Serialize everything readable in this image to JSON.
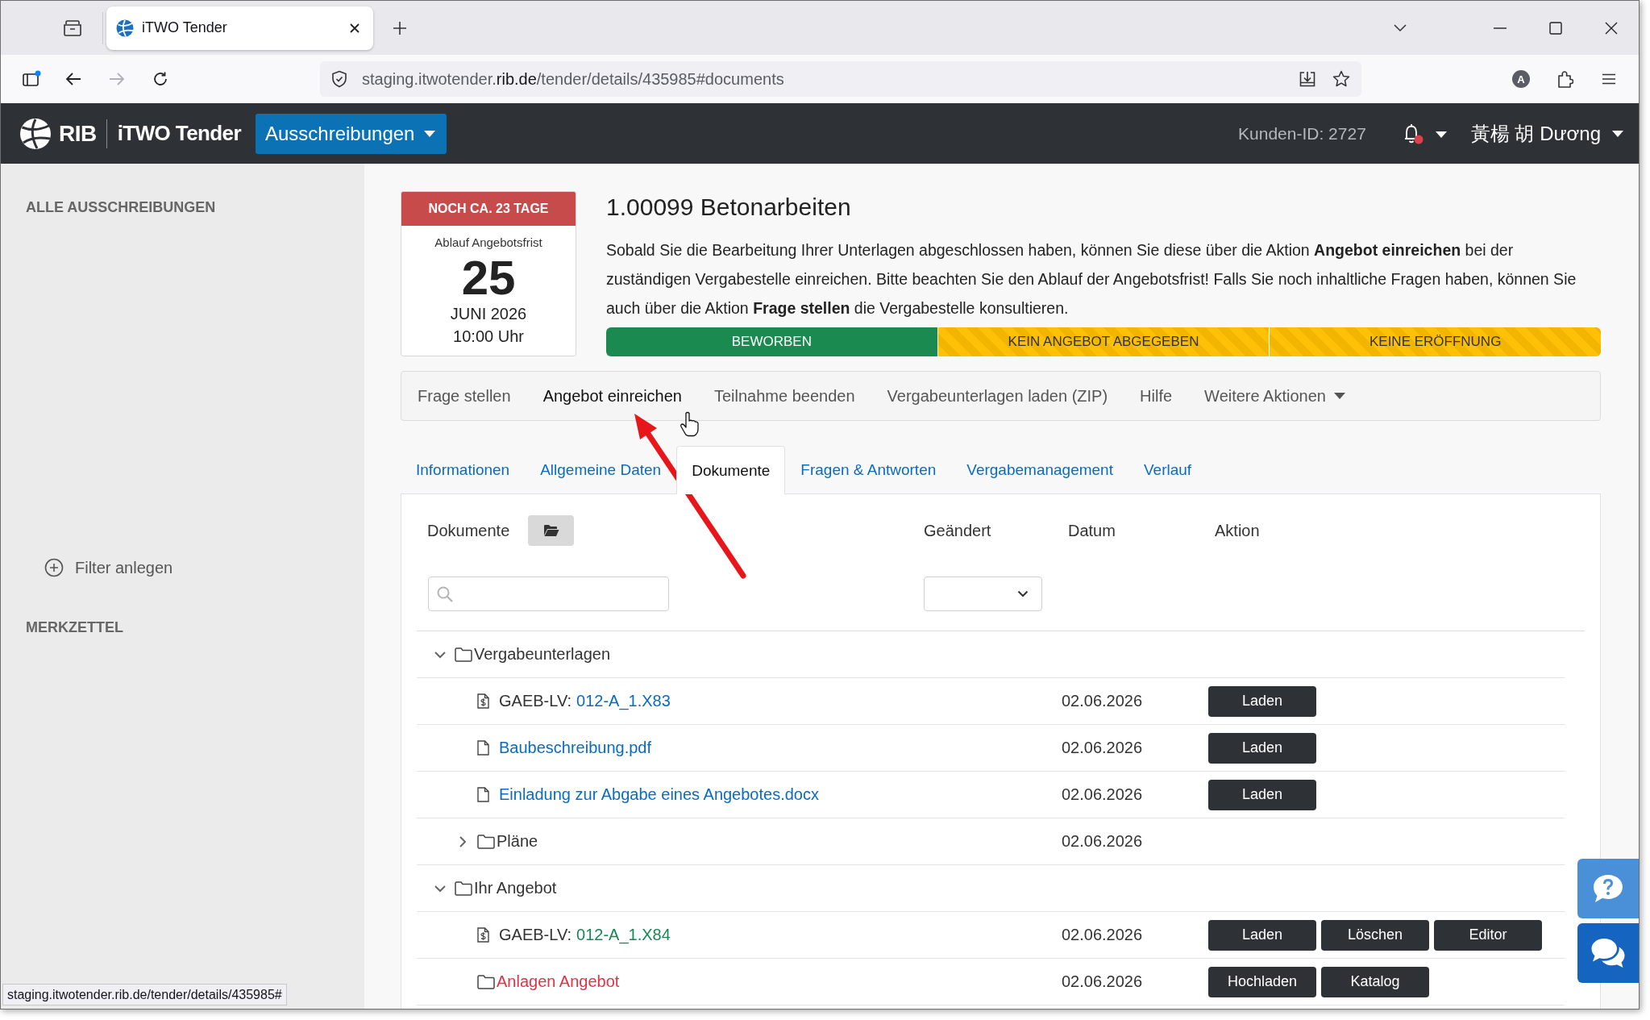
{
  "browser": {
    "tab_title": "iTWO Tender",
    "url": {
      "host": "staging.itwotender.",
      "domain": "rib.de",
      "path": "/tender/details/435985#documents"
    },
    "forward_disabled": true,
    "profile_initial": "A",
    "hover_url": "staging.itwotender.rib.de/tender/details/435985#"
  },
  "header": {
    "brand": "RIB",
    "product": "iTWO Tender",
    "menu": "Ausschreibungen",
    "customer_id": "Kunden-ID: 2727",
    "unread_notifications": true,
    "user": "黃楊 胡 Dương"
  },
  "sidebar": {
    "sections": [
      {
        "title": "ALLE AUSSCHREIBUNGEN",
        "action": "Filter anlegen"
      },
      {
        "title": "MERKZETTEL"
      }
    ]
  },
  "deadline": {
    "badge": "NOCH CA. 23 TAGE",
    "label": "Ablauf Angebotsfrist",
    "day": "25",
    "month": "JUNI 2026",
    "time": "10:00 Uhr"
  },
  "tender": {
    "title": "1.00099 Betonarbeiten",
    "description": "Sobald Sie die Bearbeitung Ihrer Unterlagen abgeschlossen haben, können Sie diese über die Aktion **Angebot einreichen** bei der zuständigen Vergabestelle einreichen. Bitte beachten Sie den Ablauf der Angebotsfrist! Falls Sie noch inhaltliche Fragen haben, können Sie auch über die Aktion **Frage stellen** die Vergabestelle konsultieren."
  },
  "status_steps": [
    {
      "label": "BEWORBEN",
      "done": true
    },
    {
      "label": "KEIN ANGEBOT ABGEGEBEN",
      "done": false
    },
    {
      "label": "KEINE ERÖFFNUNG",
      "done": false
    }
  ],
  "actions": [
    {
      "label": "Frage stellen",
      "kind": "link",
      "highlighted": false
    },
    {
      "label": "Angebot einreichen",
      "kind": "link",
      "highlighted": true
    },
    {
      "label": "Teilnahme beenden",
      "kind": "link",
      "highlighted": false
    },
    {
      "label": "Vergabeunterlagen laden (ZIP)",
      "kind": "link",
      "highlighted": false
    },
    {
      "label": "Hilfe",
      "kind": "link",
      "highlighted": false
    },
    {
      "label": "Weitere Aktionen",
      "kind": "dropdown",
      "highlighted": false
    }
  ],
  "tabs": [
    {
      "label": "Informationen",
      "selected": false
    },
    {
      "label": "Allgemeine Daten",
      "selected": false
    },
    {
      "label": "Dokumente",
      "selected": true
    },
    {
      "label": "Fragen & Antworten",
      "selected": false
    },
    {
      "label": "Vergabemanagement",
      "selected": false
    },
    {
      "label": "Verlauf",
      "selected": false
    }
  ],
  "documents": {
    "title": "Dokumente",
    "columns": [
      "Geändert",
      "Datum",
      "Aktion"
    ],
    "tree": [
      {
        "kind": "folder",
        "name": "Vergabeunterlagen",
        "expanded": true,
        "children": [
          {
            "kind": "spec",
            "prefix": "GAEB-LV:",
            "name": "012-A_1.X83",
            "color": "#0b6bbf",
            "date": "02.06.2026",
            "buttons": [
              "Laden"
            ]
          },
          {
            "kind": "file",
            "name": "Baubeschreibung.pdf",
            "color": "#0b6bbf",
            "date": "02.06.2026",
            "buttons": [
              "Laden"
            ]
          },
          {
            "kind": "file",
            "name": "Einladung zur Abgabe eines Angebotes.docx",
            "color": "#0b6bbf",
            "date": "02.06.2026",
            "buttons": [
              "Laden"
            ]
          },
          {
            "kind": "folder",
            "name": "Pläne",
            "expanded": false,
            "date": "02.06.2026"
          }
        ]
      },
      {
        "kind": "folder",
        "name": "Ihr Angebot",
        "expanded": true,
        "children": [
          {
            "kind": "spec",
            "prefix": "GAEB-LV:",
            "name": "012-A_1.X84",
            "color": "#198754",
            "date": "02.06.2026",
            "buttons": [
              "Laden",
              "Löschen",
              "Editor"
            ]
          },
          {
            "kind": "folder",
            "name": "Anlagen Angebot",
            "color": "#dc3545",
            "date": "02.06.2026",
            "buttons": [
              "Hochladen",
              "Katalog"
            ]
          }
        ]
      }
    ]
  }
}
